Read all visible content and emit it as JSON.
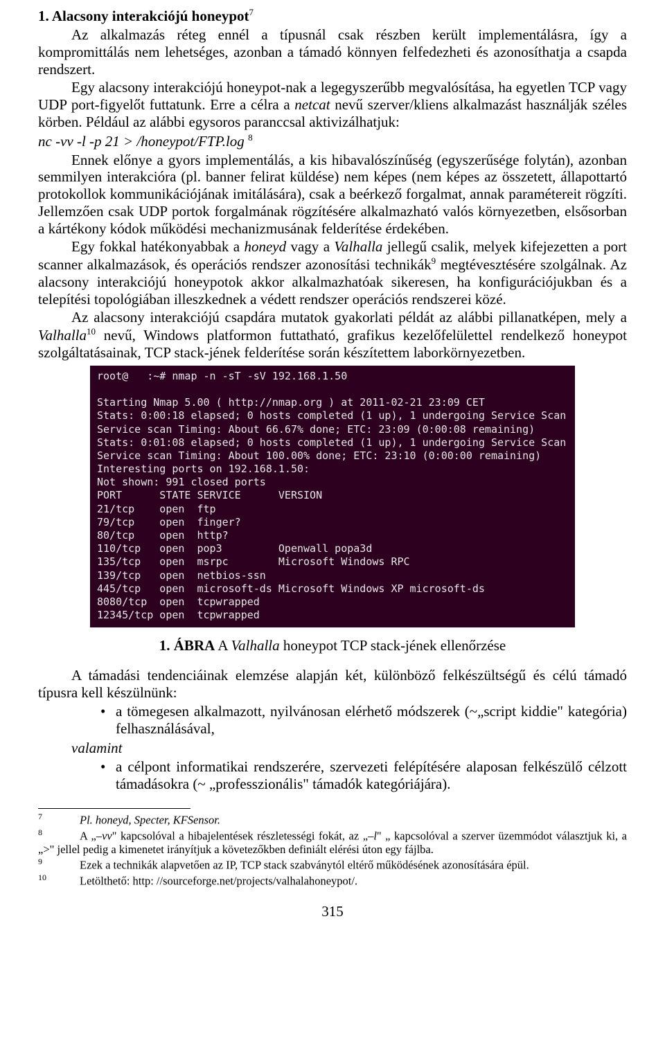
{
  "heading": "1. Alacsony interakciójú honeypot",
  "heading_fn": "7",
  "p1": "Az alkalmazás réteg ennél a típusnál csak részben került implementálásra, így a kompromittálás nem lehetséges, azonban a támadó könnyen felfedezheti és azonosíthatja a csapda rendszert.",
  "p2a": "Egy alacsony interakciójú honeypot-nak a legegyszerűbb megvalósítása, ha egyetlen TCP vagy UDP port-figyelőt futtatunk. Erre a célra a ",
  "p2b": "netcat",
  "p2c": " nevű szerver/kliens alkalmazást használják széles körben. Például az alábbi egysoros paranccsal aktivizálhatjuk:",
  "cmd": "nc -vv -l -p 21 > /honeypot/FTP.log ",
  "cmd_fn": "8",
  "p3": "Ennek előnye a gyors implementálás, a kis hibavalószínűség (egyszerűsége folytán), azonban semmilyen interakcióra (pl. banner felirat küldése) nem képes (nem képes az összetett, állapottartó protokollok kommunikációjának imitálására), csak a beérkező forgalmat, annak paramétereit rögzíti. Jellemzően csak UDP portok forgalmának rögzítésére alkalmazható valós környezetben, elsősorban a kártékony kódok működési mechanizmusának felderítése érdekében.",
  "p4a": "Egy fokkal hatékonyabbak a ",
  "p4b": "honeyd",
  "p4c": " vagy a ",
  "p4d": "Valhalla",
  "p4e": " jellegű csalik, melyek kifejezetten a port scanner alkalmazások, és operációs rendszer azonosítási technikák",
  "p4_fn": "9",
  "p4f": " megtévesztésére szolgálnak. Az alacsony interakciójú honeypotok akkor alkalmazhatóak sikeresen, ha konfigurációjukban és a telepítési topológiában illeszkednek a védett rendszer operációs rendszerei közé.",
  "p5a": "Az alacsony interakciójú csapdára mutatok gyakorlati példát az alábbi pillanatképen, mely a ",
  "p5b": "Valhalla",
  "p5_fn": "10",
  "p5c": " nevű, Windows platformon futtatható, grafikus kezelőfelülettel rendelkező honeypot szolgáltatásainak, TCP stack-jének felderítése során készítettem laborkörnyezetben.",
  "terminal": "root@   :~# nmap -n -sT -sV 192.168.1.50\n\nStarting Nmap 5.00 ( http://nmap.org ) at 2011-02-21 23:09 CET\nStats: 0:00:18 elapsed; 0 hosts completed (1 up), 1 undergoing Service Scan\nService scan Timing: About 66.67% done; ETC: 23:09 (0:00:08 remaining)\nStats: 0:01:08 elapsed; 0 hosts completed (1 up), 1 undergoing Service Scan\nService scan Timing: About 100.00% done; ETC: 23:10 (0:00:00 remaining)\nInteresting ports on 192.168.1.50:\nNot shown: 991 closed ports\nPORT      STATE SERVICE      VERSION\n21/tcp    open  ftp\n79/tcp    open  finger?\n80/tcp    open  http?\n110/tcp   open  pop3         Openwall popa3d\n135/tcp   open  msrpc        Microsoft Windows RPC\n139/tcp   open  netbios-ssn\n445/tcp   open  microsoft-ds Microsoft Windows XP microsoft-ds\n8080/tcp  open  tcpwrapped\n12345/tcp open  tcpwrapped",
  "caption_label": "1. ÁBRA",
  "caption_a": " A ",
  "caption_b": "Valhalla",
  "caption_c": " honeypot TCP stack-jének ellenőrzése",
  "p6": "A támadási tendenciáinak elemzése alapján két, különböző felkészültségű és célú támadó típusra kell készülnünk:",
  "bul1": "a tömegesen alkalmazott, nyilvánosan elérhető módszerek (~„script kiddie\" kategória) felhasználásával,",
  "valamint": "valamint",
  "bul2": "a célpont informatikai rendszerére, szervezeti felépítésére alaposan felkészülő célzott támadásokra (~ „professzionális\" támadók kategóriájára).",
  "fn7_num": "7",
  "fn7": "Pl. honeyd, Specter, KFSensor.",
  "fn8_num": "8",
  "fn8a": "A „",
  "fn8b": "–vv",
  "fn8c": "\" kapcsolóval a hibajelentések részletességi fokát, az „",
  "fn8d": "–l",
  "fn8e": "\" „ kapcsolóval a szerver üzemmódot választjuk ki, a „>\" jellel pedig a kimenetet irányítjuk a követezőkben definiált elérési úton egy fájlba.",
  "fn9_num": "9",
  "fn9": "Ezek a technikák alapvetően az IP, TCP stack szabványtól eltérő működésének azonosítására épül.",
  "fn10_num": "10",
  "fn10": "Letölthető: http: //sourceforge.net/projects/valhalahoneypot/.",
  "pagenum": "315"
}
